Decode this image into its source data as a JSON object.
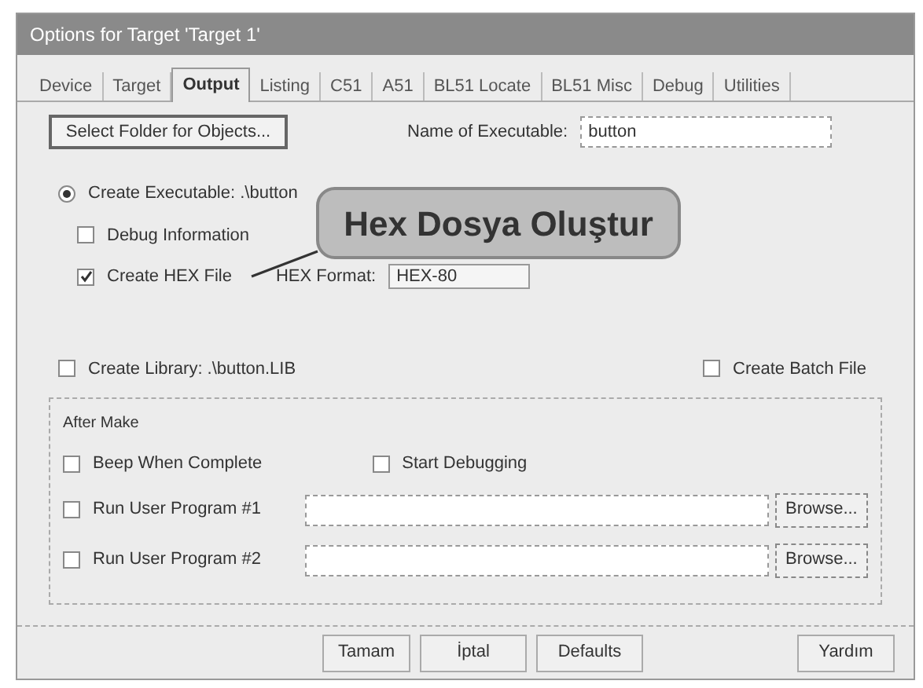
{
  "window": {
    "title": "Options for Target 'Target 1'"
  },
  "tabs": [
    {
      "label": "Device",
      "selected": false
    },
    {
      "label": "Target",
      "selected": false
    },
    {
      "label": "Output",
      "selected": true
    },
    {
      "label": "Listing",
      "selected": false
    },
    {
      "label": "C51",
      "selected": false
    },
    {
      "label": "A51",
      "selected": false
    },
    {
      "label": "BL51 Locate",
      "selected": false
    },
    {
      "label": "BL51 Misc",
      "selected": false
    },
    {
      "label": "Debug",
      "selected": false
    },
    {
      "label": "Utilities",
      "selected": false
    }
  ],
  "select_folder_button": "Select Folder for Objects...",
  "executable_name": {
    "label": "Name of Executable:",
    "value": "button"
  },
  "create_executable": {
    "label": "Create Executable:  .\\button",
    "selected": true
  },
  "debug_information": {
    "label": "Debug Information",
    "checked": false
  },
  "create_hex": {
    "label": "Create HEX File",
    "checked": true,
    "format_label": "HEX Format:",
    "format_value": "HEX-80"
  },
  "create_library": {
    "label": "Create Library:  .\\button.LIB",
    "selected": false
  },
  "create_batch": {
    "label": "Create Batch File",
    "checked": false
  },
  "after_make": {
    "title": "After Make",
    "beep": {
      "label": "Beep When Complete",
      "checked": false
    },
    "start_debugging": {
      "label": "Start Debugging",
      "checked": false
    },
    "programs": [
      {
        "label": "Run User Program #1",
        "checked": false,
        "button": "Browse..."
      },
      {
        "label": "Run User Program #2",
        "checked": false,
        "button": "Browse..."
      }
    ]
  },
  "callout": "Hex Dosya Oluştur",
  "buttons": [
    {
      "label": "Tamam"
    },
    {
      "label": "İptal"
    },
    {
      "label": "Defaults"
    },
    {
      "label": "Yardım"
    }
  ]
}
